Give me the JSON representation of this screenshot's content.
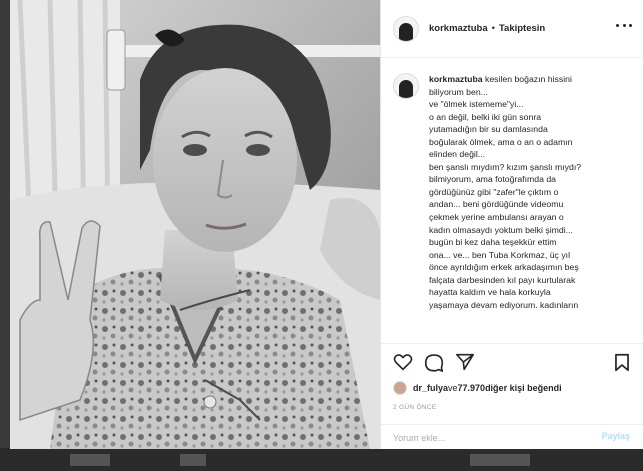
{
  "header": {
    "username": "korkmaztuba",
    "separator": "•",
    "follow_status": "Takiptesin",
    "more_icon": "more-horizontal-icon"
  },
  "caption": {
    "username": "korkmaztuba",
    "first_line_text": " kesilen boğazın hissini",
    "lines": [
      "biliyorum ben...",
      "ve \"ölmek istememe\"yi...",
      "o an değil, belki iki gün sonra",
      "yutamadığın bir su damlasında",
      "boğularak ölmek, ama o an o adamın",
      "elinden değil...",
      "ben şanslı mıydım? kızım şanslı mıydı?",
      "bilmiyorum, ama fotoğrafımda da",
      "gördüğünüz gibi \"zafer\"le çıktım o",
      "andan... beni gördüğünde videomu",
      "çekmek yerine ambulansı arayan o",
      "kadın olmasaydı yoktum belki şimdi...",
      "bugün bi kez daha teşekkür ettim",
      "ona... ve... ben Tuba Korkmaz, üç yıl",
      "önce ayrıldığım erkek arkadaşımın beş",
      "falçata darbesinden kıl payı kurtularak",
      "hayatta kaldım ve hala korkuyla",
      "yaşamaya devam ediyorum. kadınların"
    ]
  },
  "actions": {
    "like_icon": "heart-icon",
    "comment_icon": "comment-icon",
    "share_icon": "share-icon",
    "save_icon": "bookmark-icon"
  },
  "likes": {
    "user": "dr_fulya",
    "conjunction": " ve ",
    "count": "77.970",
    "suffix": " diğer kişi beğendi"
  },
  "timestamp": "2 GÜN ÖNCE",
  "comment": {
    "placeholder": "Yorum ekle...",
    "post_label": "Paylaş"
  },
  "colors": {
    "text": "#262626",
    "muted": "#999999",
    "post_disabled": "#b2dffc"
  }
}
